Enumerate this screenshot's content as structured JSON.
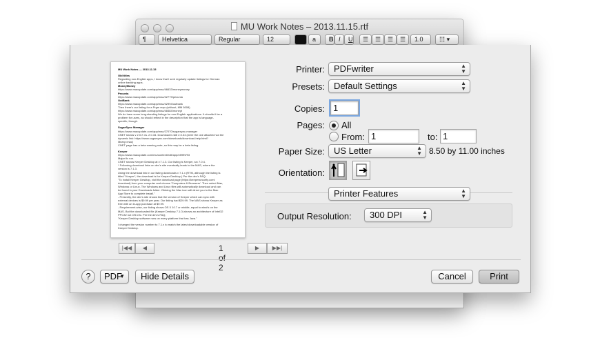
{
  "document_window": {
    "title": "MU Work Notes – 2013.11.15.rtf",
    "toolbar": {
      "paragraph_style": "¶",
      "font_family": "Helvetica",
      "font_style": "Regular",
      "font_size": "12",
      "style_label": "a",
      "bold": "B",
      "italic": "I",
      "underline": "U",
      "line_spacing": "1.0"
    }
  },
  "preview": {
    "lines": [
      {
        "text": "MU Work Notes — 2013.11.15",
        "bold": true
      },
      {
        "text": "",
        "gap": true
      },
      {
        "text": "Old titles",
        "bold": true
      },
      {
        "text": "Regarding non-English apps, I know that I sent regularly update listings for German"
      },
      {
        "text": "online banking apps."
      },
      {
        "text": "MoneyMoney",
        "bold": true
      },
      {
        "text": "https://www.macupdate.com/app/mac/46633/moneymoney"
      },
      {
        "text": "Pecunia",
        "bold": true
      },
      {
        "text": "https://www.macupdate.com/app/mac/42779/pecunia"
      },
      {
        "text": "OutBank",
        "bold": true
      },
      {
        "text": "https://www.macupdate.com/app/mac/42994/outbank"
      },
      {
        "text": "Then there's our listing for a Prgm repo (without, MM 5008)"
      },
      {
        "text": "https://www.macupdate.com/app/mac/48484/moneyt"
      },
      {
        "text": "We do have some long-standing listings for non-English applications. It shouldn't be a"
      },
      {
        "text": "problem for users, as should reflect in the description that the app is language-"
      },
      {
        "text": "specific, though."
      },
      {
        "text": "",
        "gap": true
      },
      {
        "text": "SugarSync Manager",
        "bold": true
      },
      {
        "text": "https://www.macupdate.com/app/mac/27070/sugarsync-manager"
      },
      {
        "text": "CNET shows v 2.0.X vs. 2.0.34. Download is still 2.0.34 (were the one attached via the"
      },
      {
        "text": "dynamic link: https://www.sugarsync.com/downloads/download-help.html?"
      },
      {
        "text": "library=mac)"
      },
      {
        "text": "CNET page has a beta warning note, so this may be a beta listing."
      },
      {
        "text": "",
        "gap": true
      },
      {
        "text": "Keeper",
        "bold": true
      },
      {
        "text": "https://www.macupdate.com/mu/content/edit/app/45999/93"
      },
      {
        "text": "Major fix run."
      },
      {
        "text": "CNET shows Keeper Desktop at v.7.1.3. Our listing is Keeper, src 7.0.4."
      },
      {
        "text": "* Following download links on dev's site eventually leads to the MAS, where the"
      },
      {
        "text": "version is 7.1.3."
      },
      {
        "text": "Using the download link in our listing downloads v 7.1.x (RTM, although the listing is"
      },
      {
        "text": "titled \"Keeper\", the download is for Keeper Desktop.) Per the dev's FAQ:"
      },
      {
        "text": "\"To install Keeper Desktop, visit the download page (https://keepersecurity.com/"
      },
      {
        "text": "download) from your computer and choose 'Computers & Browsers'. Then select Mac,"
      },
      {
        "text": "Windows or Linux. The Windows and Linux files will automatically download and can"
      },
      {
        "text": "be found in your Downloads folder. Clicking the Mac icon will direct you to the Mac"
      },
      {
        "text": "App Store to complete install.\""
      },
      {
        "text": "- Presently, the dev's site shows that the version of Keeper which can sync with"
      },
      {
        "text": "external devices is $9.99 per year. Our listing had $29.99. The MAS shows Keeper as"
      },
      {
        "text": "free with an in-app purchase at $9.99."
      },
      {
        "text": "- Requirement-wise, our listing shows OS X 10.7 or middle, equal to what's on the"
      },
      {
        "text": "MAS. But the downloaded file (Keeper Desktop 7.1.0) shows an architecture of Intel32"
      },
      {
        "text": "PPC32 not OS info. Per the dev's FAQ,"
      },
      {
        "text": "\"Keeper Desktop software runs on every platform that has Java.\""
      },
      {
        "text": "",
        "gap": true
      },
      {
        "text": "I changed the version number to 7.1.x to match the latest downloadable version of"
      },
      {
        "text": "Keeper Desktop."
      }
    ],
    "page_indicator": "1 of 2"
  },
  "print_dialog": {
    "printer_label": "Printer:",
    "printer_value": "PDFwriter",
    "presets_label": "Presets:",
    "presets_value": "Default Settings",
    "copies_label": "Copies:",
    "copies_value": "1",
    "pages_label": "Pages:",
    "pages_all_label": "All",
    "pages_from_label": "From:",
    "pages_from_value": "1",
    "pages_to_label": "to:",
    "pages_to_value": "1",
    "pages_selected": "all",
    "paper_size_label": "Paper Size:",
    "paper_size_value": "US Letter",
    "paper_size_dims": "8.50 by 11.00 inches",
    "orientation_label": "Orientation:",
    "orientation_selected": "portrait",
    "section_popup_value": "Printer Features",
    "output_resolution_label": "Output Resolution:",
    "output_resolution_value": "300 DPI",
    "help_label": "?",
    "pdf_label": "PDF",
    "hide_details_label": "Hide Details",
    "cancel_label": "Cancel",
    "print_label": "Print"
  }
}
